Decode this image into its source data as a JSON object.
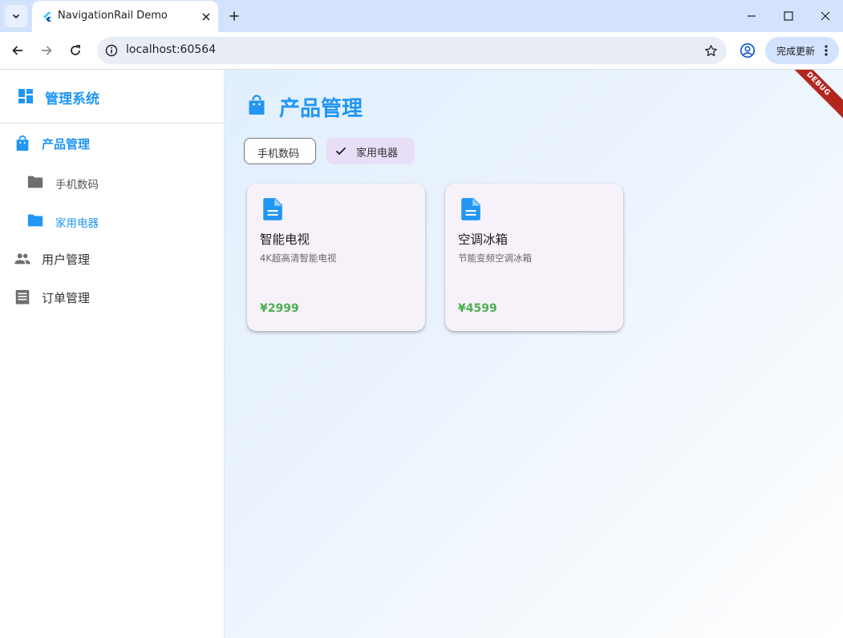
{
  "browser": {
    "tab_title": "NavigationRail Demo",
    "url": "localhost:60564",
    "update_button_label": "完成更新"
  },
  "sidebar": {
    "header_title": "管理系统",
    "items": [
      {
        "label": "产品管理",
        "icon": "shopping-bag-icon",
        "active": true
      },
      {
        "label": "手机数码",
        "icon": "folder-icon",
        "sub": true
      },
      {
        "label": "家用电器",
        "icon": "folder-icon",
        "sub": true,
        "active": true
      },
      {
        "label": "用户管理",
        "icon": "people-icon"
      },
      {
        "label": "订单管理",
        "icon": "receipt-icon"
      }
    ]
  },
  "main": {
    "page_title": "产品管理",
    "debug_banner": "DEBUG",
    "chips": [
      {
        "label": "手机数码",
        "selected": false
      },
      {
        "label": "家用电器",
        "selected": true
      }
    ],
    "products": [
      {
        "name": "智能电视",
        "description": "4K超高清智能电视",
        "price": "¥2999",
        "icon": "document-icon"
      },
      {
        "name": "空调冰箱",
        "description": "节能变频空调冰箱",
        "price": "¥4599",
        "icon": "document-icon"
      }
    ]
  },
  "colors": {
    "accent": "#2196f3",
    "price": "#4caf50",
    "chip_selected": "#e8def8",
    "card_background": "#f7f2fa",
    "tab_strip": "#d3e3fd"
  }
}
